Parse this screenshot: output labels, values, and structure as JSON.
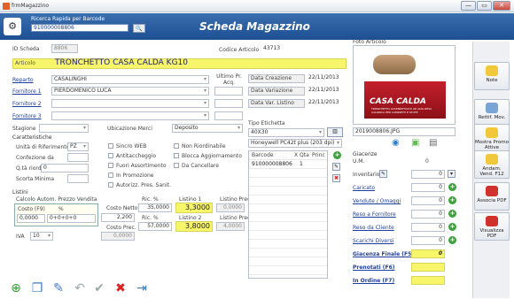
{
  "window": {
    "title": "frmMagazzino",
    "minimize": "—",
    "maximize": "▭",
    "close": "✕"
  },
  "header": {
    "search_label": "Ricerca Rapida per Barcode",
    "search_value": "910000008806",
    "title": "Scheda Magazzino",
    "search_button": "🔍"
  },
  "form": {
    "id_label": "ID Scheda",
    "id_value": "8806",
    "codice_label": "Codice Articolo",
    "codice_value": "43713",
    "articolo_label": "Articolo",
    "articolo_value": "TRONCHETTO CASA CALDA KG10",
    "reparto_label": "Reparto",
    "reparto_value": "CASALINGHI",
    "fornitore1_label": "Fornitore 1",
    "fornitore1_value": "PIERDOMENICO LUCA",
    "fornitore2_label": "Fornitore 2",
    "fornitore3_label": "Fornitore 3",
    "ultimo_label": "Ultimo Pr. Acq.",
    "data_creazione_label": "Data Creazione",
    "data_creazione_value": "22/11/2013",
    "data_variazione_label": "Data Variazione",
    "data_variazione_value": "22/11/2013",
    "data_listino_label": "Data Var. Listino",
    "data_listino_value": "22/11/2013",
    "stagione_label": "Stagione",
    "ubicazione_label": "Ubicazione Merci",
    "ubicazione_value": "Deposito",
    "caratteristiche_label": "Caratteristiche",
    "unita_label": "Unità di Riferimento",
    "unita_value": "PZ",
    "confezione_label": "Confezione da",
    "qta_riordino_label": "Q.tà riordino",
    "qta_riordino_value": "0",
    "scorta_label": "Scorta Minima",
    "checks": [
      "Sincro WEB",
      "Antitaccheggio",
      "Fuori Assortimento",
      "In Promozione",
      "Autorizz. Pres. Sanit.",
      "Non Riordinabile",
      "Blocca Aggiornamento",
      "Da Cancellare"
    ]
  },
  "listini": {
    "title": "Listini",
    "calc_label": "Calcolo Autom. Prezzo Vendita",
    "costo_header": "Costo (F9)",
    "pct_header": "%",
    "costo_value": "0,0000",
    "pct_value": "0+0+0+0",
    "costo_netto_label": "Costo Netto",
    "costo_netto_value": "2,200",
    "costo_prec_label": "Costo Prec.",
    "costo_prec_value": "0,0000",
    "iva_label": "IVA",
    "iva_value": "10",
    "ric1_label": "Ric. %",
    "ric1_value": "35,0000",
    "ric2_label": "Ric. %",
    "ric2_value": "57,0000",
    "listino1_label": "Listino 1",
    "listino1_value": "3,3000",
    "listino2_label": "Listino 2",
    "listino2_value": "3,8000",
    "listino_prec1_label": "Listino Prec.",
    "listino_prec1_value": "0,0000",
    "listino_prec2_label": "Listino Prec.",
    "listino_prec2_value": "4,0000"
  },
  "etichetta": {
    "title": "Tipo Etichetta",
    "size_value": "40X30",
    "printer_value": "Honeywell PC42t plus (203 dpi)",
    "table_headers": [
      "Barcode",
      "X Qta",
      "Princ"
    ],
    "rows": [
      {
        "barcode": "910000008806",
        "qta": "1",
        "princ": ""
      }
    ]
  },
  "foto": {
    "title": "Foto Articolo",
    "filename": "2019008806.JPG",
    "product_text": "CASA CALDA",
    "product_sub": "TRONCHETTO ACCENDIFUOCO AD ALTA RESA CALORICA PER CAMINETTI E STUFE"
  },
  "giacenze": {
    "title": "Giacenze",
    "um_label": "U.M.",
    "um_value": "0",
    "inventario_label": "Inventario",
    "inventario_value": "0",
    "caricato_label": "Caricato",
    "caricato_value": "0",
    "vendute_label": "Vendute / Omaggi",
    "vendute_value": "0",
    "reso_fornitore_label": "Reso a Fornitore",
    "reso_fornitore_value": "0",
    "reso_cliente_label": "Reso da Cliente",
    "reso_cliente_value": "0",
    "scarichi_label": "Scarichi Diversi",
    "scarichi_value": "0",
    "giacenza_label": "Giacenza Finale (F5)",
    "giacenza_value": "0",
    "prenotati_label": "Prenotati (F6)",
    "ordine_label": "In Ordine (F7)"
  },
  "side_buttons": {
    "note": "Note",
    "rettif": "Rettif. Mov.",
    "mostra": "Mostra Promo Attive",
    "andam": "Andam. Vend. F12",
    "associa": "Associa PDF",
    "visualizza": "Visualizza PDF"
  },
  "colors": {
    "header": "#1d4f92",
    "highlight": "#f7f56a",
    "link": "#1f3f9f"
  }
}
